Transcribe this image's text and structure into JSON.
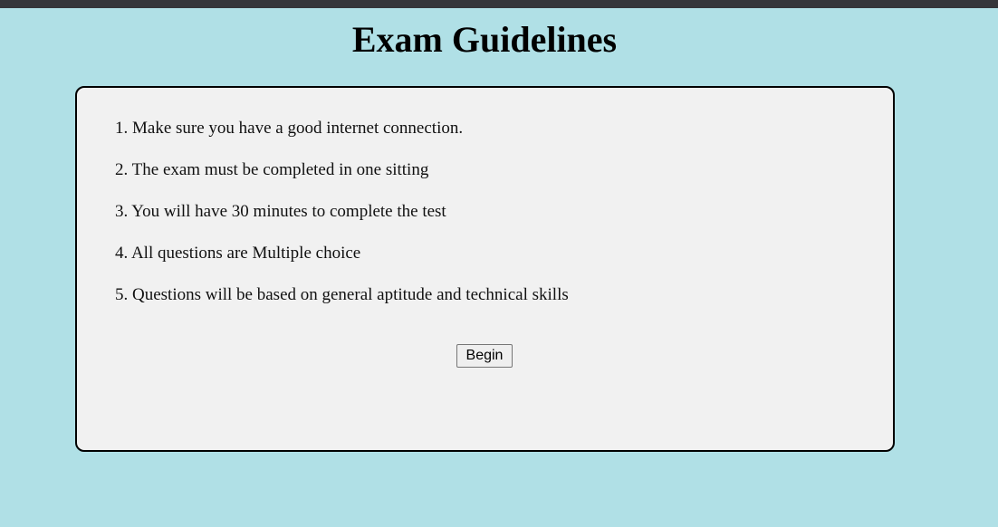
{
  "page": {
    "title": "Exam Guidelines"
  },
  "guidelines": [
    "1. Make sure you have a good internet connection.",
    "2. The exam must be completed in one sitting",
    "3. You will have 30 minutes to complete the test",
    "4. All questions are Multiple choice",
    "5. Questions will be based on general aptitude and technical skills"
  ],
  "actions": {
    "begin_label": "Begin"
  },
  "colors": {
    "page_background": "#b0e0e6",
    "card_background": "#f1f1f1",
    "top_strip": "#35363a"
  }
}
